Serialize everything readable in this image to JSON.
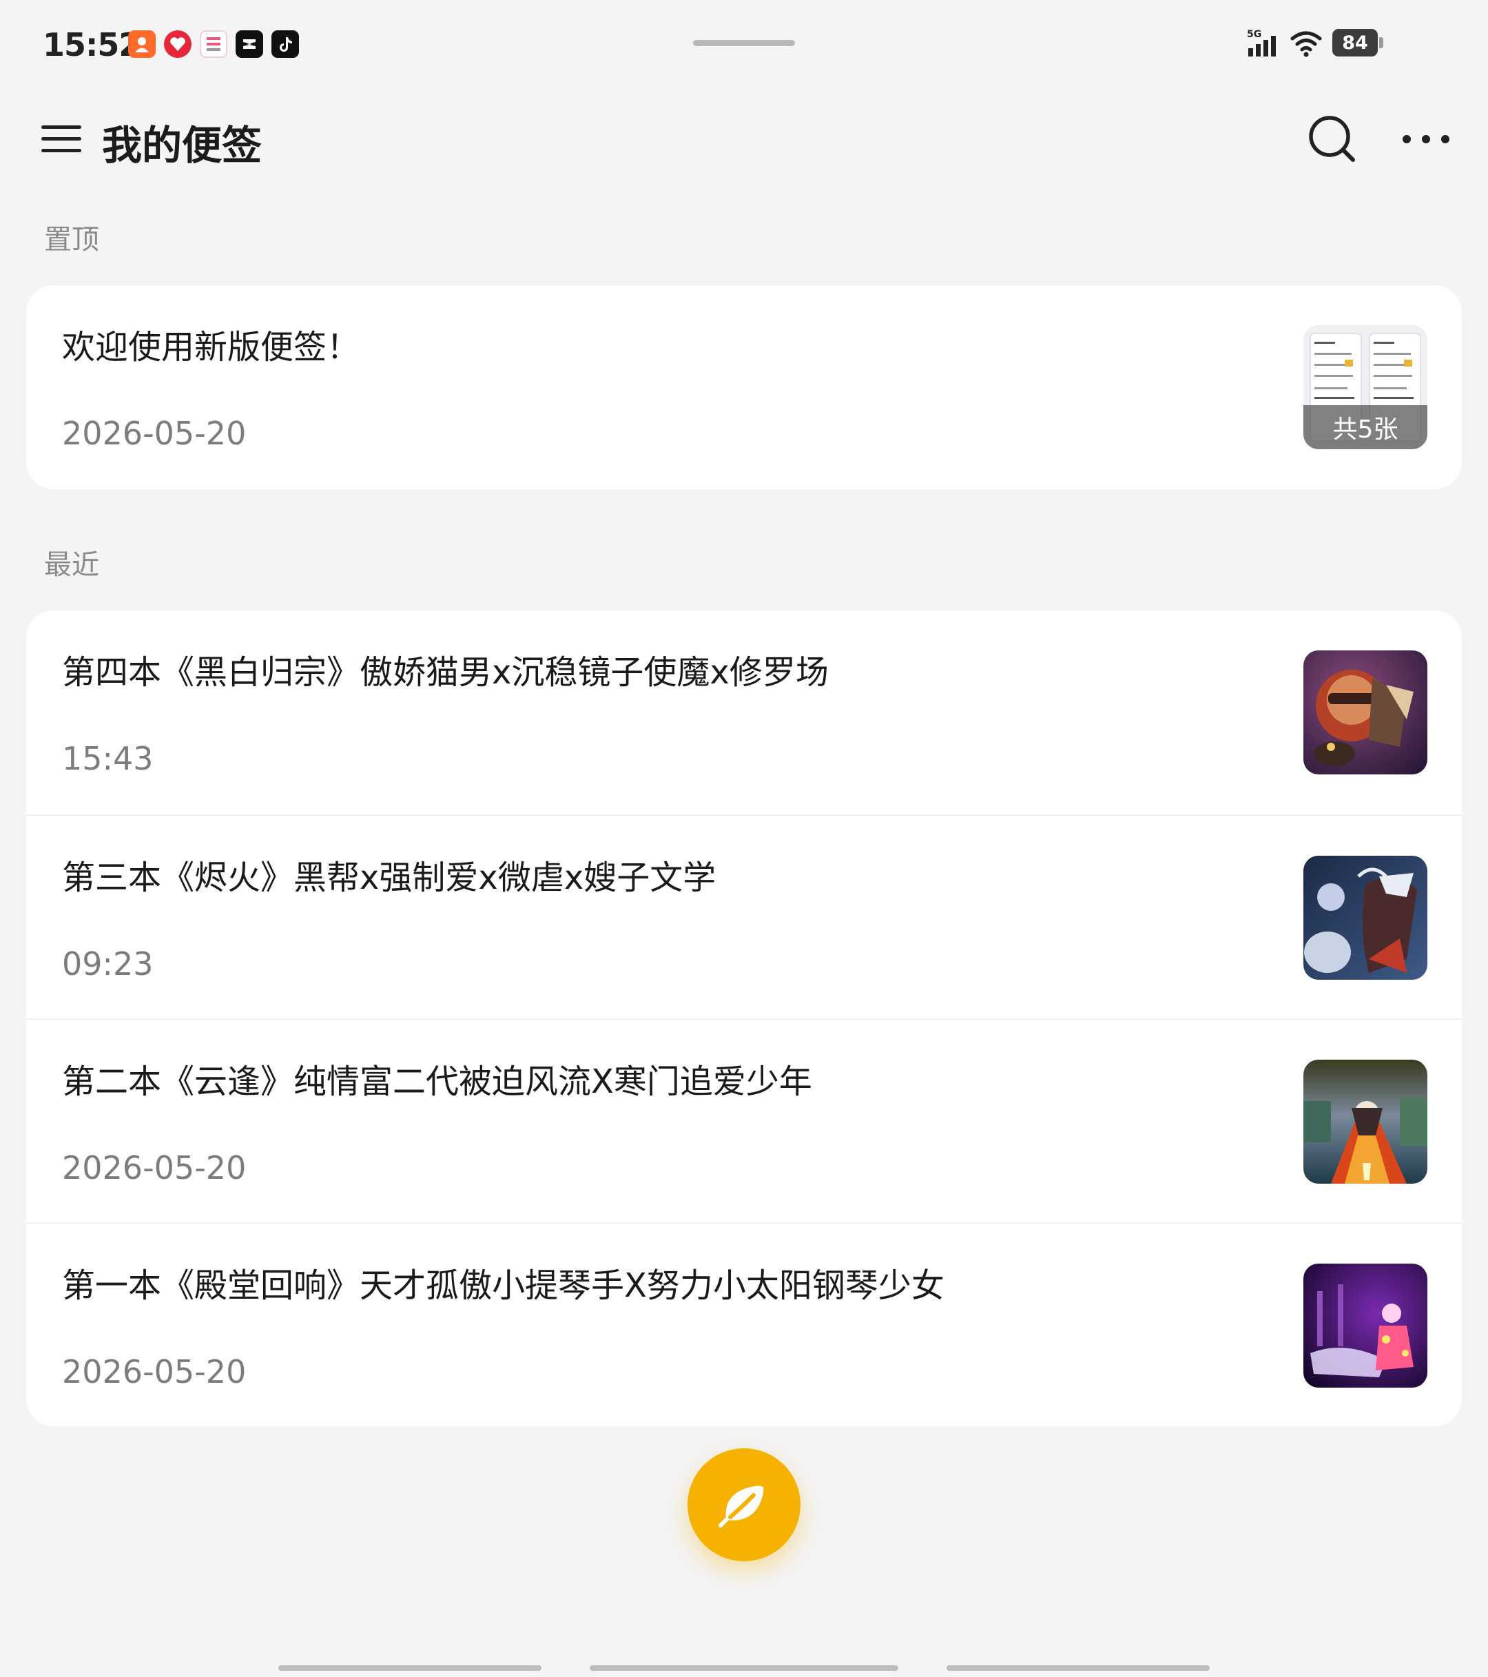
{
  "status_bar": {
    "time": "15:52",
    "battery": "84",
    "signal": "5G",
    "notification_icons": [
      "app-icon-orange",
      "app-icon-red",
      "app-icon-pink-text",
      "capcut-icon",
      "tiktok-icon"
    ]
  },
  "app_bar": {
    "title": "我的便签",
    "menu_icon": "hamburger-menu-icon",
    "search_icon": "search-icon",
    "more_icon": "more-dots-icon"
  },
  "sections": {
    "pinned_label": "置顶",
    "recent_label": "最近"
  },
  "pinned_notes": [
    {
      "title": "欢迎使用新版便签！",
      "date": "2026-05-20",
      "thumb_count": "共5张"
    }
  ],
  "recent_notes": [
    {
      "title": "第四本《黑白归宗》傲娇猫男x沉稳镜子使魔x修罗场",
      "date": "15:43"
    },
    {
      "title": "第三本《烬火》黑帮x强制爱x微虐x嫂子文学",
      "date": "09:23"
    },
    {
      "title": "第二本《云逢》纯情富二代被迫风流X寒门追爱少年",
      "date": "2026-05-20"
    },
    {
      "title": "第一本《殿堂回响》天才孤傲小提琴手X努力小太阳钢琴少女",
      "date": "2026-05-20"
    }
  ],
  "fab": {
    "icon": "feather-pen-icon"
  },
  "colors": {
    "background": "#f4f4f4",
    "card": "#ffffff",
    "accent": "#f6b200",
    "secondary_text": "#7c7c7c"
  }
}
